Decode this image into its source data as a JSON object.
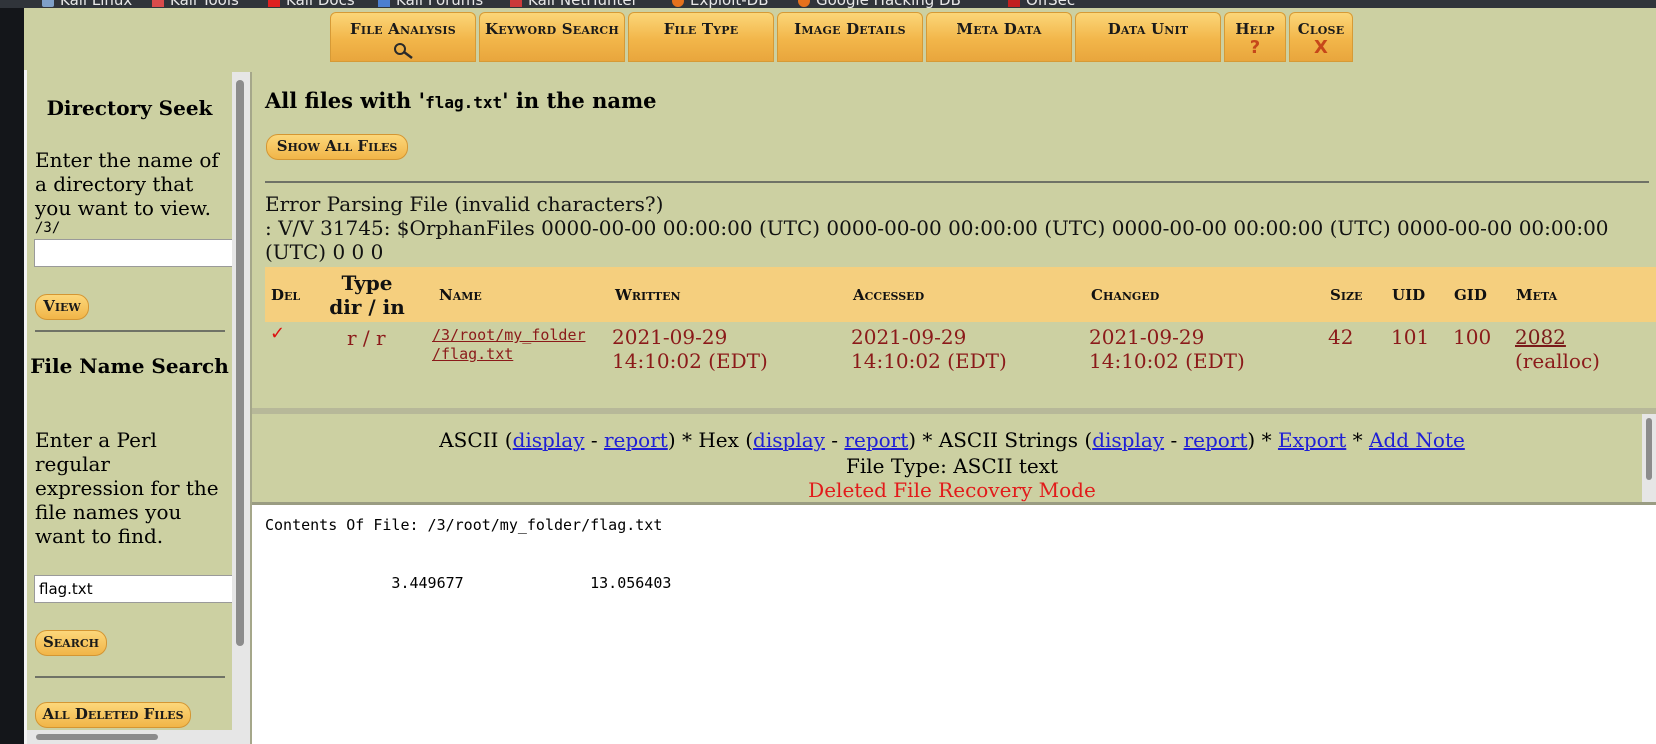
{
  "bookmarks": [
    {
      "label": "Kali Linux",
      "icon": "kali-icon"
    },
    {
      "label": "Kali Tools",
      "icon": "kali-tools-icon"
    },
    {
      "label": "Kali Docs",
      "icon": "kali-docs-icon"
    },
    {
      "label": "Kali Forums",
      "icon": "kali-forums-icon"
    },
    {
      "label": "Kali NetHunter",
      "icon": "nethunter-icon"
    },
    {
      "label": "Exploit-DB",
      "icon": "exploit-db-icon"
    },
    {
      "label": "Google Hacking DB",
      "icon": "ghdb-icon"
    },
    {
      "label": "OffSec",
      "icon": "offsec-icon"
    }
  ],
  "nav": {
    "file_analysis": "File Analysis",
    "keyword_search": "Keyword Search",
    "file_type": "File Type",
    "image_details": "Image Details",
    "meta_data": "Meta Data",
    "data_unit": "Data Unit",
    "help": "Help",
    "help_glyph": "?",
    "close": "Close",
    "close_glyph": "X"
  },
  "sidebar": {
    "dir_seek_title": "Directory Seek",
    "dir_seek_text": "Enter the name of a directory that you want to view.",
    "dir_path": "/3/",
    "dir_input_value": "",
    "view_button": "View",
    "file_search_title": "File Name Search",
    "file_search_text": "Enter a Perl regular expression for the file names you want to find.",
    "file_search_value": "flag.txt",
    "search_button": "Search",
    "all_deleted_button": "All Deleted Files"
  },
  "main": {
    "heading_prefix": "All files with '",
    "heading_term": "flag.txt",
    "heading_suffix": "' in the name",
    "show_all_button": "Show All Files",
    "error_line1": "Error Parsing File (invalid characters?)",
    "error_line2": ": V/V 31745: $OrphanFiles 0000-00-00 00:00:00 (UTC) 0000-00-00 00:00:00 (UTC) 0000-00-00 00:00:00 (UTC) 0000-00-00 00:00:00 (UTC) 0 0 0"
  },
  "table": {
    "headers": {
      "del": "Del",
      "type_line1": "Type",
      "type_line2": "dir / in",
      "name": "Name",
      "written": "Written",
      "accessed": "Accessed",
      "changed": "Changed",
      "size": "Size",
      "uid": "UID",
      "gid": "GID",
      "meta": "Meta"
    },
    "row": {
      "del_mark": "✓",
      "type": "r / r",
      "name_line1": "/3/root/my_folder",
      "name_line2": "/flag.txt",
      "written_date": "2021-09-29",
      "written_time": "14:10:02 (EDT)",
      "accessed_date": "2021-09-29",
      "accessed_time": "14:10:02 (EDT)",
      "changed_date": "2021-09-29",
      "changed_time": "14:10:02 (EDT)",
      "size": "42",
      "uid": "101",
      "gid": "100",
      "meta": "2082",
      "meta_note": "(realloc)"
    }
  },
  "viewer": {
    "ascii": "ASCII (",
    "ascii_display": "display",
    "dash1": " - ",
    "ascii_report": "report",
    "hex": ") * Hex (",
    "hex_display": "display",
    "dash2": " - ",
    "hex_report": "report",
    "strings": ") * ASCII Strings (",
    "strings_display": "display",
    "dash3": " - ",
    "strings_report": "report",
    "sep4": ") * ",
    "export": "Export",
    "sep5": " * ",
    "add_note": "Add Note",
    "file_type": "File Type: ASCII text",
    "recovery_mode": "Deleted File Recovery Mode"
  },
  "contents": {
    "title": "Contents Of File: /3/root/my_folder/flag.txt",
    "body": "              3.449677              13.056403"
  },
  "colors": {
    "page_bg": "#ccd0a2",
    "tab_gold": "#f2b64a",
    "table_header": "#f5cf7e",
    "link_blue": "#1f1fd6",
    "data_red": "#8b1a1a",
    "alert_red": "#e21a1a"
  }
}
